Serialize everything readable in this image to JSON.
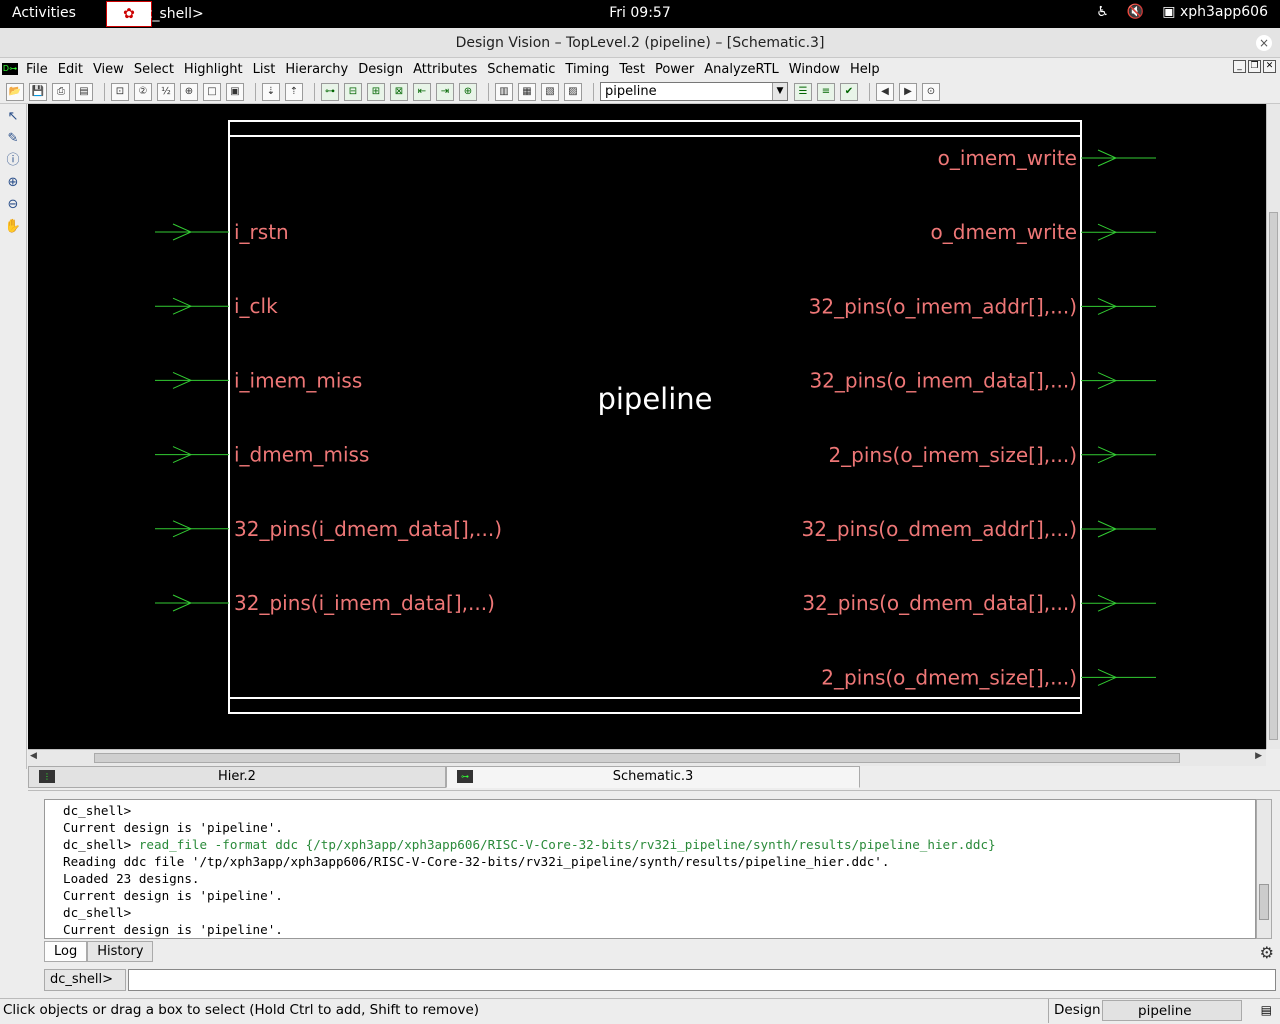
{
  "topbar": {
    "activities": "Activities",
    "app_name": "Dc_shell>",
    "clock": "Fri 09:57",
    "user": "xph3app606"
  },
  "window": {
    "title": "Design Vision – TopLevel.2 (pipeline) – [Schematic.3]",
    "close": "×"
  },
  "menu": {
    "items": [
      "File",
      "Edit",
      "View",
      "Select",
      "Highlight",
      "List",
      "Hierarchy",
      "Design",
      "Attributes",
      "Schematic",
      "Timing",
      "Test",
      "Power",
      "AnalyzeRTL",
      "Window",
      "Help"
    ]
  },
  "toolbar": {
    "design_select": "pipeline"
  },
  "schematic": {
    "block_name": "pipeline",
    "input_pins": [
      "i_rstn",
      "i_clk",
      "i_imem_miss",
      "i_dmem_miss",
      "32_pins(i_dmem_data[],...)",
      "32_pins(i_imem_data[],...)"
    ],
    "output_pins": [
      "o_imem_write",
      "o_dmem_write",
      "32_pins(o_imem_addr[],...)",
      "32_pins(o_imem_data[],...)",
      "2_pins(o_imem_size[],...)",
      "32_pins(o_dmem_addr[],...)",
      "32_pins(o_dmem_data[],...)",
      "2_pins(o_dmem_size[],...)"
    ],
    "colors": {
      "background": "#000000",
      "outline": "#ffffff",
      "pin_text": "#ee7777",
      "block_text": "#ffffff",
      "wire": "#33cc33"
    }
  },
  "tabs": {
    "hier": "Hier.2",
    "schematic": "Schematic.3"
  },
  "log": {
    "lines": [
      {
        "text": "dc_shell>",
        "cmd": ""
      },
      {
        "text": "Current design is 'pipeline'.",
        "cmd": ""
      },
      {
        "text": "dc_shell> ",
        "cmd": "read_file -format ddc {/tp/xph3app/xph3app606/RISC-V-Core-32-bits/rv32i_pipeline/synth/results/pipeline_hier.ddc}"
      },
      {
        "text": "Reading ddc file '/tp/xph3app/xph3app606/RISC-V-Core-32-bits/rv32i_pipeline/synth/results/pipeline_hier.ddc'.",
        "cmd": ""
      },
      {
        "text": "Loaded 23 designs.",
        "cmd": ""
      },
      {
        "text": "Current design is 'pipeline'.",
        "cmd": ""
      },
      {
        "text": "dc_shell>",
        "cmd": ""
      },
      {
        "text": "Current design is 'pipeline'.",
        "cmd": ""
      }
    ],
    "tab_log": "Log",
    "tab_history": "History",
    "prompt": "dc_shell>",
    "input_value": ""
  },
  "status": {
    "message": "Click objects or drag a box to select (Hold Ctrl to add, Shift to remove)",
    "design_label": "Design",
    "design_value": "pipeline"
  }
}
